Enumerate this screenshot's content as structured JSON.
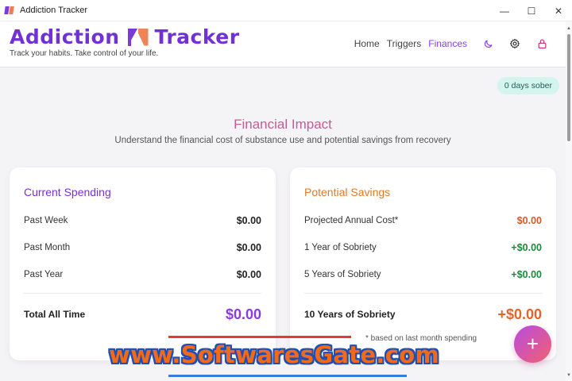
{
  "window": {
    "title": "Addiction Tracker",
    "controls": {
      "minimize": "—",
      "maximize": "☐",
      "close": "✕"
    }
  },
  "header": {
    "brand_part1": "Addiction",
    "brand_part2": "Tracker",
    "tagline": "Track your habits. Take control of your life.",
    "nav": [
      {
        "label": "Home",
        "active": false
      },
      {
        "label": "Triggers",
        "active": false
      },
      {
        "label": "Finances",
        "active": true
      }
    ],
    "icons": [
      "moon-icon",
      "settings-gear-icon",
      "lock-icon"
    ]
  },
  "badge": {
    "text": "0 days sober"
  },
  "section": {
    "title": "Financial Impact",
    "subtitle": "Understand the financial cost of substance use and potential savings from recovery"
  },
  "current_spending": {
    "title": "Current Spending",
    "rows": [
      {
        "label": "Past Week",
        "value": "$0.00"
      },
      {
        "label": "Past Month",
        "value": "$0.00"
      },
      {
        "label": "Past Year",
        "value": "$0.00"
      }
    ],
    "total_label": "Total All Time",
    "total_value": "$0.00"
  },
  "potential_savings": {
    "title": "Potential Savings",
    "rows": [
      {
        "label": "Projected Annual Cost*",
        "value": "$0.00"
      },
      {
        "label": "1 Year of Sobriety",
        "value": "+$0.00"
      },
      {
        "label": "5 Years of Sobriety",
        "value": "+$0.00"
      }
    ],
    "total_label": "10 Years of Sobriety",
    "total_value": "+$0.00",
    "footnote": "* based on last month spending"
  },
  "fab": {
    "symbol": "+"
  },
  "watermark": {
    "text": "www.SoftwaresGate.com"
  },
  "colors": {
    "accent_purple": "#7a30d8",
    "accent_orange": "#e07a26",
    "positive_green": "#1c8a3a",
    "cost_red": "#d8562c",
    "title_pink": "#c45c98",
    "badge_bg": "#d3f5ee"
  }
}
